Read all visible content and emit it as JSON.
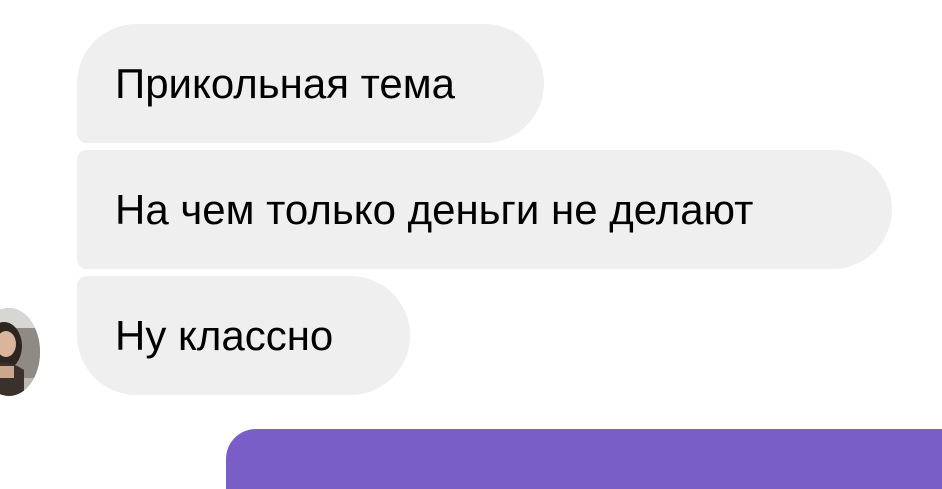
{
  "messages": [
    {
      "text": "Прикольная тема",
      "direction": "incoming"
    },
    {
      "text": "На чем только деньги не делают",
      "direction": "incoming"
    },
    {
      "text": "Ну классно",
      "direction": "incoming"
    }
  ],
  "colors": {
    "incoming_bubble": "#efefef",
    "outgoing_bubble": "#7a5ec8",
    "background": "#ffffff"
  },
  "icons": {
    "sender_avatar": "sender-avatar"
  }
}
